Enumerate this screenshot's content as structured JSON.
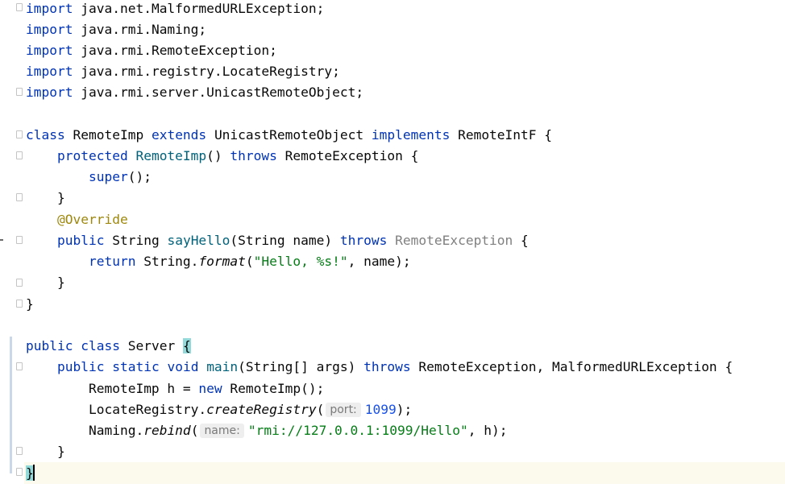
{
  "editor": {
    "imports": [
      {
        "kw": "import",
        "path": "java.net.MalformedURLException;"
      },
      {
        "kw": "import",
        "path": "java.rmi.Naming;"
      },
      {
        "kw": "import",
        "path": "java.rmi.RemoteException;"
      },
      {
        "kw": "import",
        "path": "java.rmi.registry.LocateRegistry;"
      },
      {
        "kw": "import",
        "path": "java.rmi.server.UnicastRemoteObject;"
      }
    ],
    "class1": {
      "kw_class": "class",
      "name": "RemoteImp",
      "kw_extends": "extends",
      "super": "UnicastRemoteObject",
      "kw_implements": "implements",
      "iface": "RemoteIntF",
      "open": "{",
      "ctor_mod": "protected",
      "ctor_name": "RemoteImp",
      "ctor_params": "()",
      "kw_throws": "throws",
      "ctor_ex": "RemoteException",
      "ctor_open": "{",
      "super_call": "super",
      "super_rest": "();",
      "close_inner": "}",
      "annotation": "@Override",
      "m_mod": "public",
      "m_type": "String",
      "m_name": "sayHello",
      "m_params": "(String name)",
      "m_throws": "throws",
      "m_ex": "RemoteException",
      "m_open": "{",
      "ret_kw": "return",
      "ret_cls": "String.",
      "ret_fn": "format",
      "ret_open": "(",
      "ret_str": "\"Hello, %s!\"",
      "ret_rest": ", name);",
      "close_method": "}",
      "close": "}"
    },
    "class2": {
      "kw_public": "public",
      "kw_class": "class",
      "name": "Server",
      "open": "{",
      "m_public": "public",
      "m_static": "static",
      "m_void": "void",
      "m_name": "main",
      "m_params": "(String[] args)",
      "m_throws": "throws",
      "m_ex": "RemoteException, MalformedURLException",
      "m_open": "{",
      "l1_a": "RemoteImp h = ",
      "l1_new": "new",
      "l1_b": " RemoteImp();",
      "l2_cls": "LocateRegistry.",
      "l2_fn": "createRegistry",
      "l2_open": "(",
      "l2_hint": "port:",
      "l2_num": "1099",
      "l2_close": ");",
      "l3_cls": "Naming.",
      "l3_fn": "rebind",
      "l3_open": "(",
      "l3_hint": "name:",
      "l3_str": "\"rmi://127.0.0.1:1099/Hello\"",
      "l3_rest": ", h);",
      "close_method": "}",
      "close": "}"
    }
  }
}
